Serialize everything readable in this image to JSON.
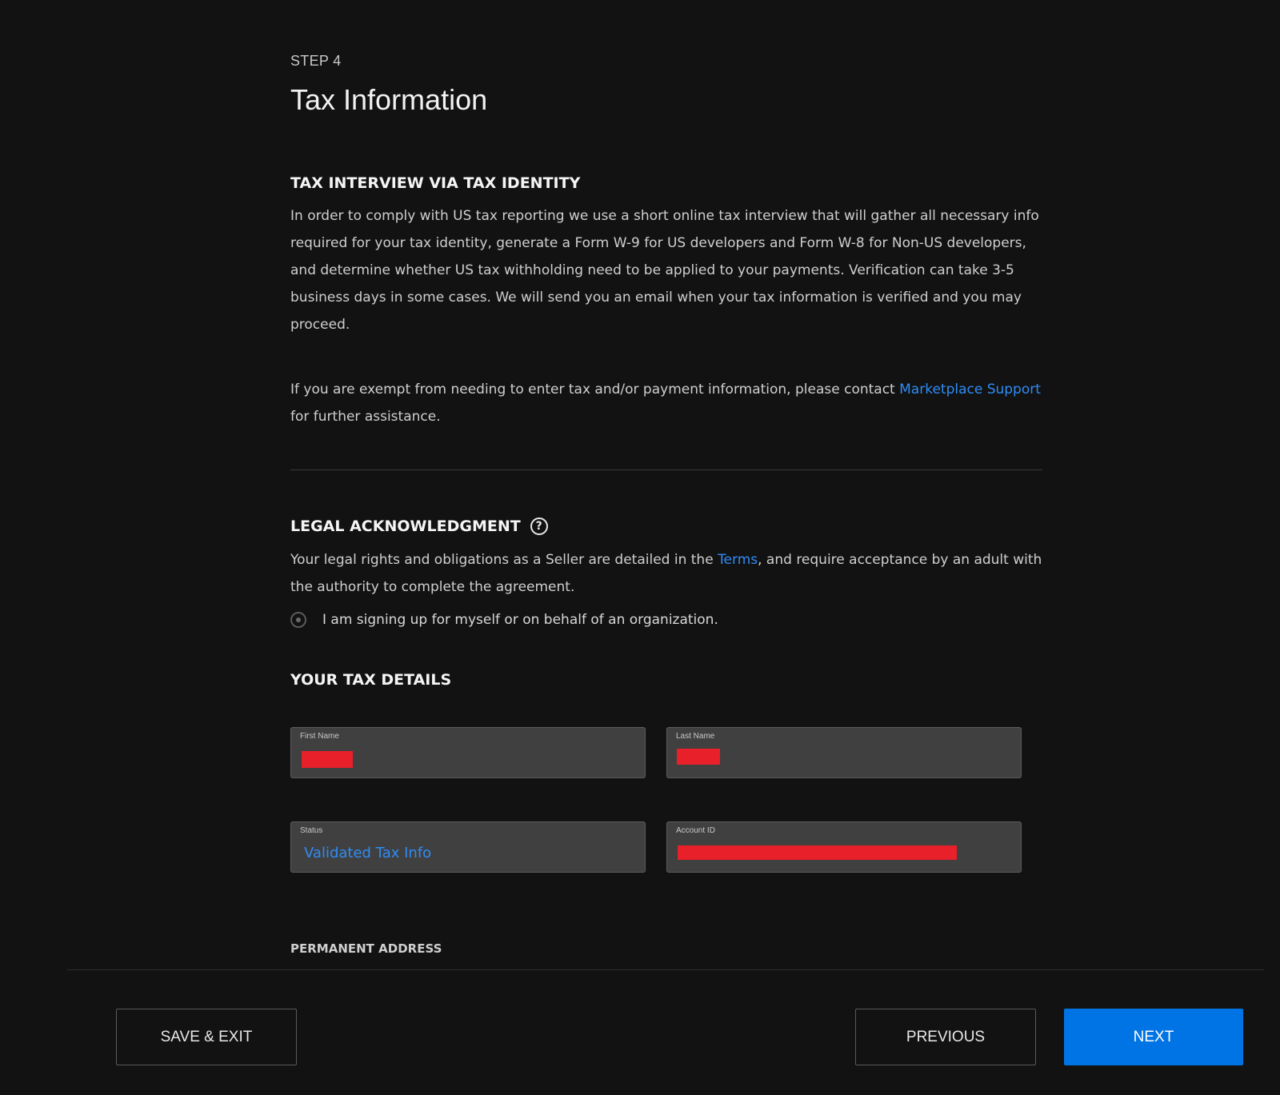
{
  "header": {
    "step_label": "STEP 4",
    "title": "Tax Information"
  },
  "tax_interview": {
    "heading": "TAX INTERVIEW VIA TAX IDENTITY",
    "body": "In order to comply with US tax reporting we use a short online tax interview that will gather all necessary info required for your tax identity, generate a Form W-9 for US developers and Form W-8 for Non-US developers, and determine whether US tax withholding need to be applied to your payments. Verification can take 3-5 business days in some cases. We will send you an email when your tax information is verified and you may proceed.",
    "exempt_prefix": "If you are exempt from needing to enter tax and/or payment information, please contact ",
    "exempt_link": "Marketplace Support",
    "exempt_suffix": " for further assistance."
  },
  "legal": {
    "heading": "LEGAL ACKNOWLEDGMENT",
    "help_icon": "?",
    "body_prefix": "Your legal rights and obligations as a Seller are detailed in the ",
    "terms_link": "Terms",
    "body_suffix": ", and require acceptance by an adult with the authority to complete the agreement.",
    "radio_label": "I am signing up for myself or on behalf of an organization."
  },
  "tax_details": {
    "heading": "YOUR TAX DETAILS",
    "first_name_label": "First Name",
    "last_name_label": "Last Name",
    "status_label": "Status",
    "status_value": "Validated Tax Info",
    "account_id_label": "Account ID"
  },
  "address": {
    "heading": "PERMANENT ADDRESS"
  },
  "footer": {
    "save_exit": "SAVE & EXIT",
    "previous": "PREVIOUS",
    "next": "NEXT"
  },
  "colors": {
    "background": "#121212",
    "accent": "#0074e4",
    "link": "#2f8cf6",
    "redaction": "#e8202a"
  }
}
